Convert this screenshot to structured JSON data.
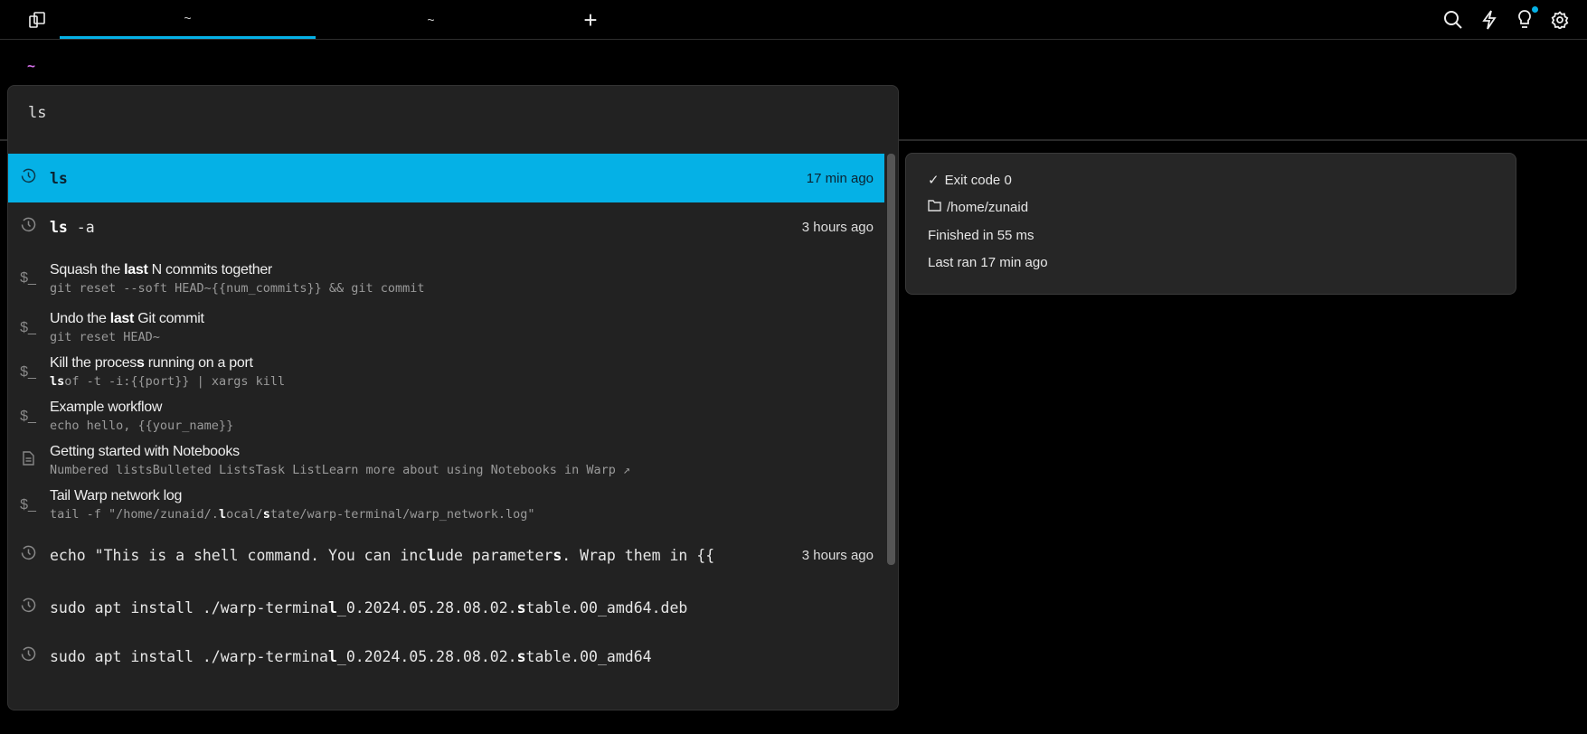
{
  "tabbar": {
    "tabs": [
      {
        "label": "~",
        "active": true
      },
      {
        "label": "~",
        "active": false
      }
    ],
    "icons": [
      "panels-icon",
      "plus-icon",
      "search-icon",
      "bolt-icon",
      "bulb-icon",
      "gear-icon"
    ],
    "accent": "#05b1e6"
  },
  "prompt": "~",
  "palette": {
    "query": "ls",
    "items": [
      {
        "kind": "history",
        "cmd": [
          [
            "ls",
            1
          ]
        ],
        "time": "17 min ago",
        "selected": true
      },
      {
        "kind": "history",
        "cmd": [
          [
            "ls",
            1
          ],
          [
            " -a",
            0
          ]
        ],
        "time": "3 hours ago"
      },
      {
        "kind": "workflow",
        "title": [
          [
            "Squash the ",
            0
          ],
          [
            "last",
            1
          ],
          [
            " N commits together",
            0
          ]
        ],
        "sub": [
          [
            "git reset --soft HEAD~{{num_commits}} && git commit",
            0
          ]
        ]
      },
      {
        "kind": "workflow",
        "title": [
          [
            "Undo the ",
            0
          ],
          [
            "last",
            1
          ],
          [
            " Git commit",
            0
          ]
        ],
        "sub": [
          [
            "git reset HEAD~",
            0
          ]
        ]
      },
      {
        "kind": "workflow",
        "title": [
          [
            "Kill the proces",
            0
          ],
          [
            "s",
            1
          ],
          [
            " running on a port",
            0
          ]
        ],
        "sub": [
          [
            "ls",
            1
          ],
          [
            "of -t -i:{{port}} | xargs kill",
            0
          ]
        ]
      },
      {
        "kind": "workflow",
        "title": [
          [
            "Example workflow",
            0
          ]
        ],
        "sub": [
          [
            "echo hello, {{your_name}}",
            0
          ]
        ]
      },
      {
        "kind": "notebook",
        "title": [
          [
            "Getting started with Notebooks",
            0
          ]
        ],
        "sub": [
          [
            "Nu",
            0
          ],
          [
            "mbered listsBulleted ListsTask ListLearn more about using Notebooks in Warp ↗",
            0
          ]
        ]
      },
      {
        "kind": "workflow",
        "title": [
          [
            "Tail Warp network log",
            0
          ]
        ],
        "sub": [
          [
            "tail -f \"/home/zunaid/.",
            0
          ],
          [
            "l",
            1
          ],
          [
            "ocal/",
            0
          ],
          [
            "s",
            1
          ],
          [
            "tate/warp-terminal/warp_network.log\"",
            0
          ]
        ]
      },
      {
        "kind": "history",
        "cmd": [
          [
            "echo \"This is a shell command. You can inc",
            0
          ],
          [
            "l",
            1
          ],
          [
            "ude parameter",
            0
          ],
          [
            "s",
            1
          ],
          [
            ". Wrap them in {{",
            0
          ]
        ],
        "time": "3 hours ago"
      },
      {
        "kind": "history",
        "cmd": [
          [
            "sudo apt install ./warp-termina",
            0
          ],
          [
            "l",
            1
          ],
          [
            "_0.2024.05.28.08.02.",
            0
          ],
          [
            "s",
            1
          ],
          [
            "table.00_amd64.deb",
            0
          ]
        ]
      },
      {
        "kind": "history",
        "cmd": [
          [
            "sudo apt install ./warp-termina",
            0
          ],
          [
            "l",
            1
          ],
          [
            "_0.2024.05.28.08.02.",
            0
          ],
          [
            "s",
            1
          ],
          [
            "table.00_amd64",
            0
          ]
        ]
      }
    ]
  },
  "info": {
    "exit": "Exit code 0",
    "dir": "/home/zunaid",
    "duration": "Finished in 55 ms",
    "last_ran": "Last ran 17 min ago"
  }
}
